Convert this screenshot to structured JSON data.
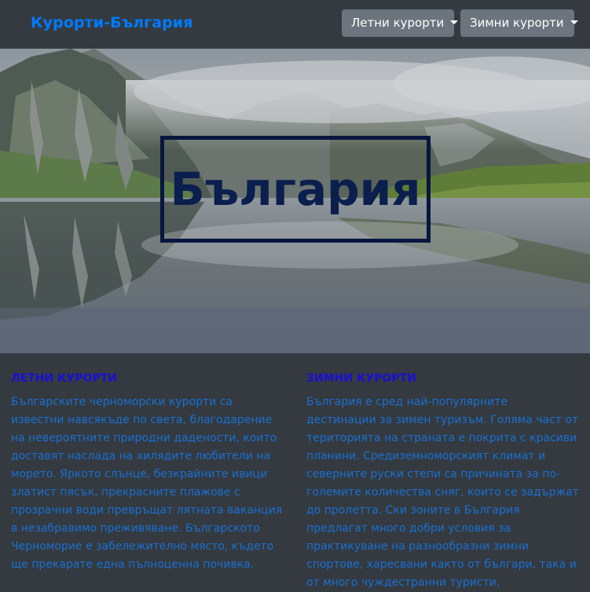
{
  "navbar": {
    "brand": "Курорти-България",
    "summer_dropdown": "Летни курорти",
    "winter_dropdown": "Зимни курорти"
  },
  "hero": {
    "title": "България",
    "image_icon": "mountain-lake-photo"
  },
  "summer": {
    "heading": "ЛЕТНИ КУРОРТИ",
    "text": "Българските черноморски курорти са известни навсякъде по света, благодарение на невероятните природни дадености, които доставят наслада на хилядите любители на морето. Яркото слънце, безкрайните ивици златист пясък, прекрасните плажове с прозрачни води превръщат лятната ваканция в незабравимо преживяване. Българското Черноморие е забележително място, където ще прекарате една пълноценна почивка."
  },
  "winter": {
    "heading": "ЗИМНИ КУРОРТИ",
    "text": "България е сред най-популярните дестинации за зимен туризъм. Голяма част от територията на страната е покрита с красиви планини. Средиземноморският климат и северните руски степи са причината за по-големите количества сняг, които се задържат до пролетта. Ски зоните в България предлагат много добри условия за практикуване на разнообразни зимни спортове, харесвани както от българи, така и от много чуждестранни туристи."
  },
  "colors": {
    "navbar_bg": "#343a40",
    "brand": "#007bff",
    "dropdown_bg": "#6c757d",
    "heading": "#1a0fd6",
    "body_text": "#1a6fd1",
    "title": "#0a1f4d"
  }
}
